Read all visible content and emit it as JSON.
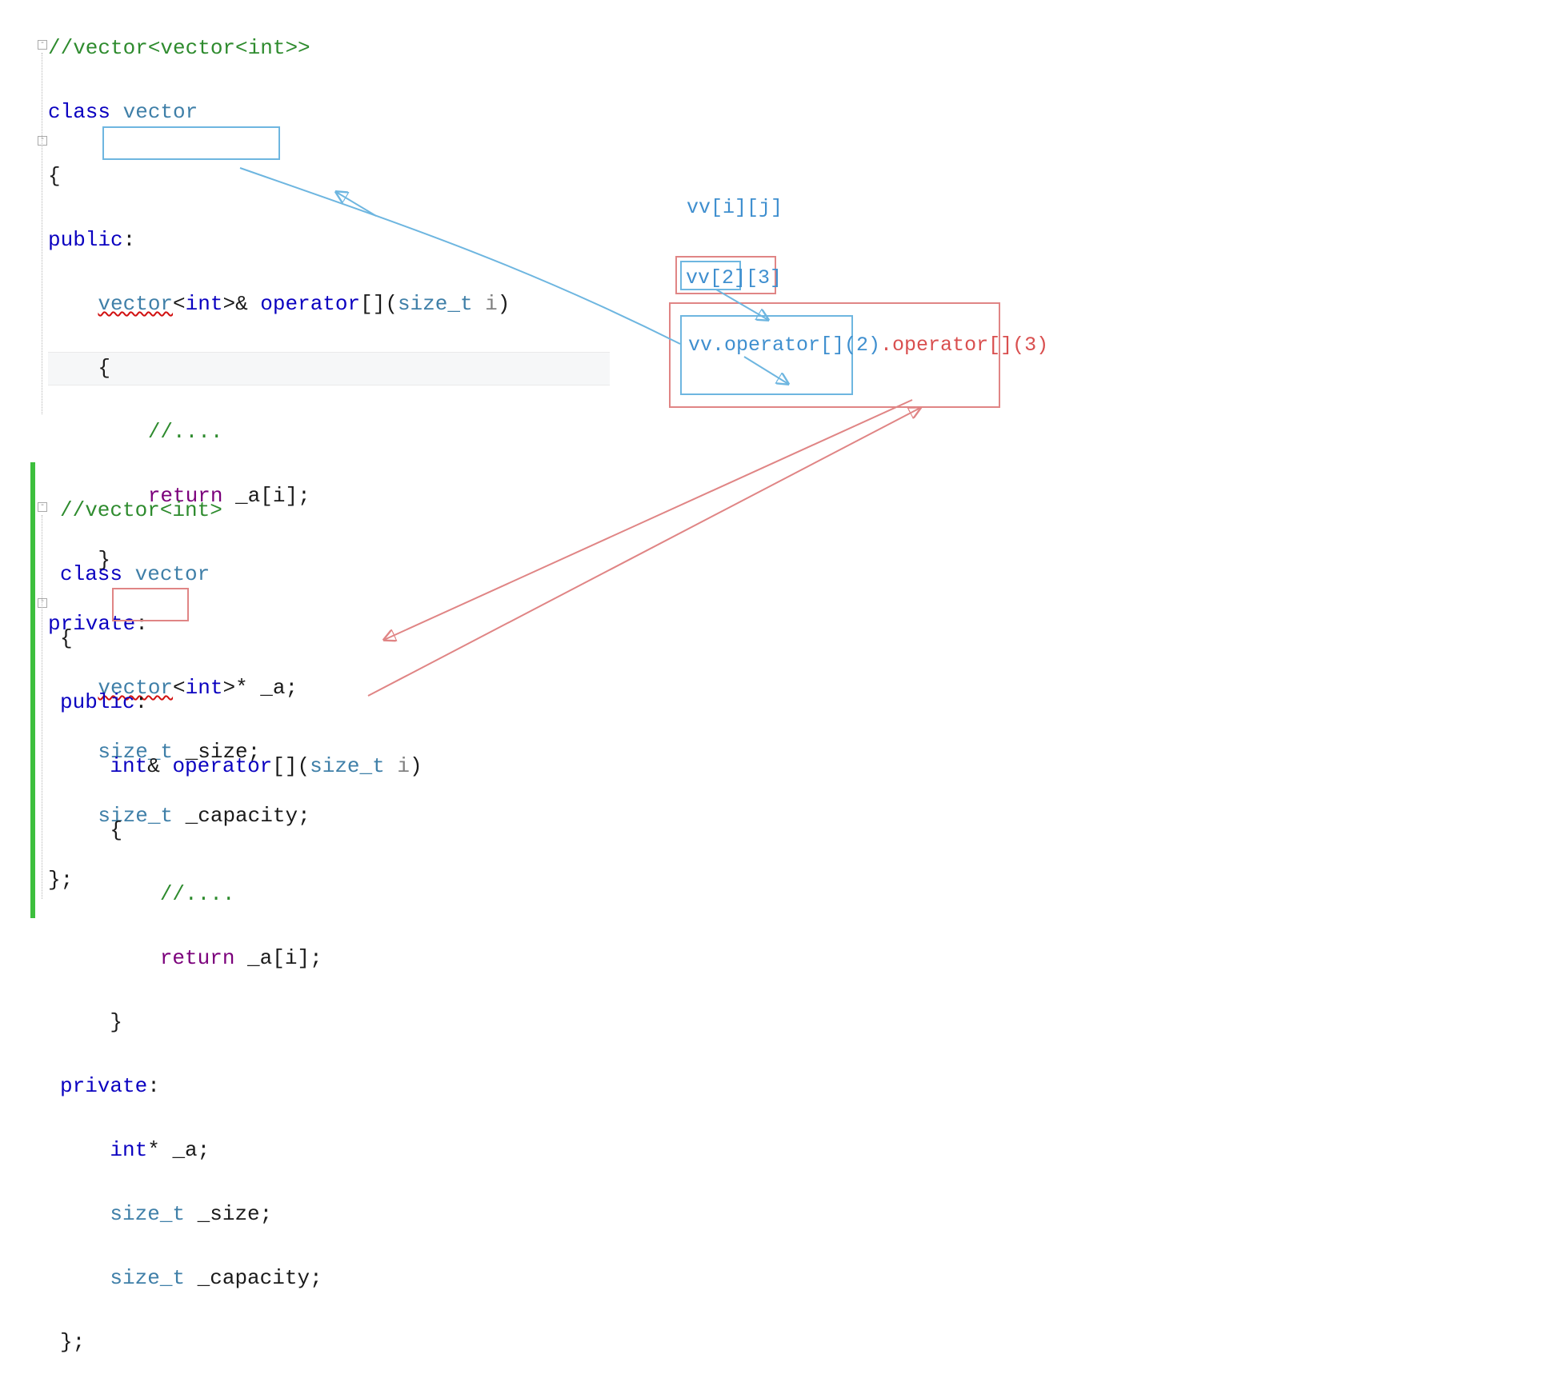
{
  "block1": {
    "comment": "//vector<vector<int>>",
    "class_kw": "class",
    "class_name": "vector",
    "open_brace": "{",
    "public_kw": "public",
    "ret_type_prefix": "vector",
    "ret_type_inner": "int",
    "ret_type_suffix": ">& ",
    "op_name": "operator",
    "op_brackets": "[]",
    "param_type": "size_t",
    "param_name": " i",
    "body_comment": "//....",
    "return_kw": "return",
    "return_expr": " _a[i];",
    "private_kw": "private",
    "member1_a": "vector",
    "member1_b": "int",
    "member1_c": ">* _a;",
    "member2_type": "size_t",
    "member2_name": " _size;",
    "member3_type": "size_t",
    "member3_name": " _capacity;",
    "close": "};"
  },
  "block2": {
    "comment": "//vector<int>",
    "class_kw": "class",
    "class_name": "vector",
    "open_brace": "{",
    "public_kw": "public",
    "ret_type": "int",
    "ret_amp": "& ",
    "op_name": "operator",
    "op_brackets": "[]",
    "param_type": "size_t",
    "param_name": " i",
    "body_comment": "//....",
    "return_kw": "return",
    "return_expr": " _a[i];",
    "private_kw": "private",
    "member1_type": "int",
    "member1_name": "* _a;",
    "member2_type": "size_t",
    "member2_name": " _size;",
    "member3_type": "size_t",
    "member3_name": " _capacity;",
    "close": "};"
  },
  "annot": {
    "vvij": "vv[i][j]",
    "vv23": "vv[2][3]",
    "call1": "vv.operator[](2)",
    "call2": ".operator[](3)"
  }
}
